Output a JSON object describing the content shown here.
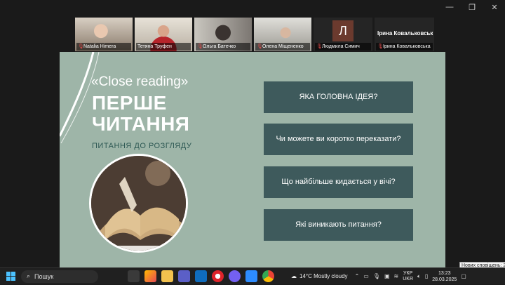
{
  "participants": [
    {
      "name": "Natalia Himera",
      "muted": true,
      "active": false,
      "bg": "#b9a894"
    },
    {
      "name": "Тетяна Труфен",
      "muted": false,
      "active": true,
      "bg": "#c9c0b5"
    },
    {
      "name": "Ольга Батечко",
      "muted": true,
      "active": false,
      "bg": "#8f8c86"
    },
    {
      "name": "Олена Міщененко",
      "muted": true,
      "active": false,
      "bg": "#b7b5ad"
    },
    {
      "name": "Людмила Симич",
      "initial": "Л",
      "muted": true,
      "active": false
    },
    {
      "name": "Ірина Ковальковська",
      "display": "Ірина  Ковальковськ",
      "muted": true,
      "active": false
    }
  ],
  "slide": {
    "close_reading": "«Close reading»",
    "title_line1": "ПЕРШЕ",
    "title_line2": "ЧИТАННЯ",
    "subtitle": "ПИТАННЯ ДО РОЗГЛЯДУ",
    "questions": [
      "ЯКА ГОЛОВНА ІДЕЯ?",
      "Чи можете ви коротко переказати?",
      "Що найбільше кидається у вічі?",
      "Які виникають питання?"
    ],
    "bg_color": "#9eb5a8",
    "box_color": "#3e5a5c"
  },
  "taskbar": {
    "search_label": "Пошук",
    "weather": "14°C  Mostly cloudy",
    "lang_top": "УКР",
    "lang_bottom": "UKR",
    "time": "13:23",
    "date": "28.03.2025"
  },
  "notification_tooltip": "Нових сповіщень: 2"
}
